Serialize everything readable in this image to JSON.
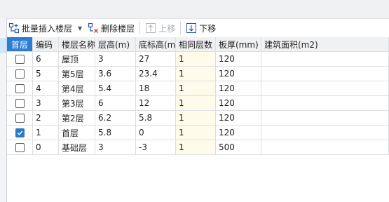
{
  "toolbar": {
    "batch_insert": "批量插入楼层",
    "delete_floor": "删除楼层",
    "move_up": "上移",
    "move_down": "下移"
  },
  "table": {
    "headers": [
      "首层",
      "编码",
      "楼层名称",
      "层高(m)",
      "底标高(m)",
      "相同层数",
      "板厚(mm)",
      "建筑面积(m2)"
    ],
    "rows": [
      {
        "checked": false,
        "code": "6",
        "name": "屋顶",
        "height": "3",
        "bottom": "27",
        "same": "1",
        "thick": "120",
        "area": ""
      },
      {
        "checked": false,
        "code": "5",
        "name": "第5层",
        "height": "3.6",
        "bottom": "23.4",
        "same": "1",
        "thick": "120",
        "area": ""
      },
      {
        "checked": false,
        "code": "4",
        "name": "第4层",
        "height": "5.4",
        "bottom": "18",
        "same": "1",
        "thick": "120",
        "area": ""
      },
      {
        "checked": false,
        "code": "3",
        "name": "第3层",
        "height": "6",
        "bottom": "12",
        "same": "1",
        "thick": "120",
        "area": ""
      },
      {
        "checked": false,
        "code": "2",
        "name": "第2层",
        "height": "6.2",
        "bottom": "5.8",
        "same": "1",
        "thick": "120",
        "area": ""
      },
      {
        "checked": true,
        "code": "1",
        "name": "首层",
        "height": "5.8",
        "bottom": "0",
        "same": "1",
        "thick": "120",
        "area": ""
      },
      {
        "checked": false,
        "code": "0",
        "name": "基础层",
        "height": "3",
        "bottom": "-3",
        "same": "1",
        "thick": "500",
        "area": ""
      }
    ]
  },
  "colors": {
    "accent": "#2d7dd2",
    "checkbox_on": "#2b78c5",
    "highlight": "#fffbea"
  }
}
